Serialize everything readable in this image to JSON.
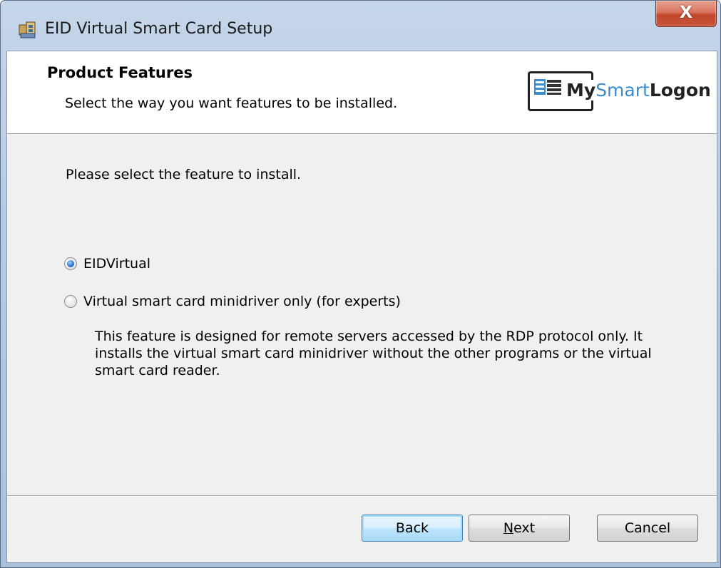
{
  "window": {
    "title": "EID Virtual Smart Card Setup",
    "close_label": "X"
  },
  "banner": {
    "title": "Product Features",
    "subtitle": "Select the way you want features to be installed.",
    "logo": {
      "my": "My",
      "smart": "Smart",
      "logon": "Logon"
    }
  },
  "content": {
    "instruction": "Please select the feature to install.",
    "options": [
      {
        "label": "EIDVirtual",
        "selected": true
      },
      {
        "label": "Virtual smart card minidriver only (for experts)",
        "selected": false
      }
    ],
    "description": "This feature is designed for remote servers accessed by the RDP protocol only. It installs the virtual smart card minidriver without the other programs or the virtual smart card reader."
  },
  "buttons": {
    "back": "Back",
    "next_mnemonic": "N",
    "next_rest": "ext",
    "cancel": "Cancel"
  },
  "colors": {
    "logo_accent": "#3a8ccf",
    "default_button_border": "#3c7fb1",
    "close_button": "#c7563b"
  }
}
